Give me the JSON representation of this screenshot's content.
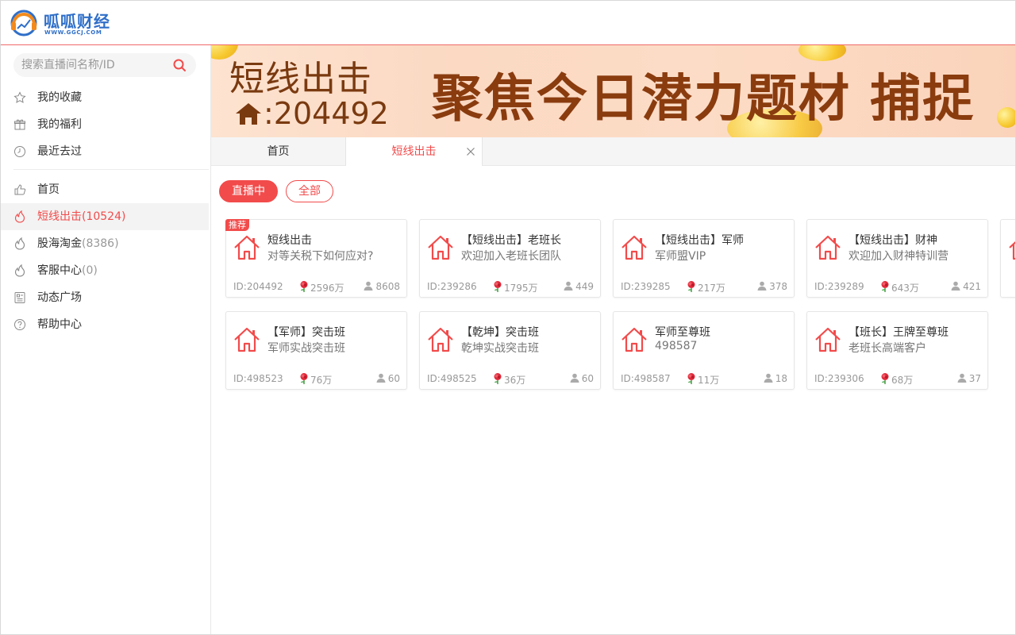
{
  "header": {
    "logo_text": "呱呱财经",
    "logo_url": "WWW.GGCJ.COM"
  },
  "search": {
    "placeholder": "搜索直播间名称/ID"
  },
  "sidebar": {
    "top_items": [
      {
        "label": "我的收藏",
        "icon": "star-icon"
      },
      {
        "label": "我的福利",
        "icon": "gift-icon"
      },
      {
        "label": "最近去过",
        "icon": "clock-icon"
      }
    ],
    "items": [
      {
        "label": "首页",
        "count": "",
        "icon": "thumbs-up-icon",
        "active": false
      },
      {
        "label": "短线出击",
        "count": "(10524)",
        "icon": "flame-icon",
        "active": true
      },
      {
        "label": "股海淘金",
        "count": "(8386)",
        "icon": "flame-icon",
        "active": false
      },
      {
        "label": "客服中心",
        "count": "(0)",
        "icon": "flame-icon",
        "active": false
      },
      {
        "label": "动态广场",
        "count": "",
        "icon": "feed-icon",
        "active": false
      },
      {
        "label": "帮助中心",
        "count": "",
        "icon": "help-icon",
        "active": false
      }
    ]
  },
  "banner": {
    "title": "短线出击",
    "room": ":204492",
    "slogan": "聚焦今日潜力题材  捕捉"
  },
  "tabs": [
    {
      "label": "首页"
    },
    {
      "label": "短线出击"
    }
  ],
  "filters": {
    "live": "直播中",
    "all": "全部"
  },
  "cards": [
    {
      "badge": "推荐",
      "title": "短线出击",
      "subtitle": "对等关税下如何应对?",
      "id": "ID:204492",
      "flowers": "2596万",
      "users": "8608"
    },
    {
      "badge": "",
      "title": "【短线出击】老班长",
      "subtitle": "欢迎加入老班长团队",
      "id": "ID:239286",
      "flowers": "1795万",
      "users": "449"
    },
    {
      "badge": "",
      "title": "【短线出击】军师",
      "subtitle": "军师盟VIP",
      "id": "ID:239285",
      "flowers": "217万",
      "users": "378"
    },
    {
      "badge": "",
      "title": "【短线出击】财神",
      "subtitle": "欢迎加入财神特训营",
      "id": "ID:239289",
      "flowers": "643万",
      "users": "421"
    },
    {
      "badge": "",
      "title": "【军师】突击班",
      "subtitle": "军师实战突击班",
      "id": "ID:498523",
      "flowers": "76万",
      "users": "60"
    },
    {
      "badge": "",
      "title": "【乾坤】突击班",
      "subtitle": "乾坤实战突击班",
      "id": "ID:498525",
      "flowers": "36万",
      "users": "60"
    },
    {
      "badge": "",
      "title": "军师至尊班",
      "subtitle": "498587",
      "id": "ID:498587",
      "flowers": "11万",
      "users": "18"
    },
    {
      "badge": "",
      "title": "【班长】王牌至尊班",
      "subtitle": "老班长高端客户",
      "id": "ID:239306",
      "flowers": "68万",
      "users": "37"
    }
  ],
  "colors": {
    "accent": "#f24b4b",
    "logo_blue": "#2f6fc9",
    "banner_text": "#7a3a10"
  }
}
